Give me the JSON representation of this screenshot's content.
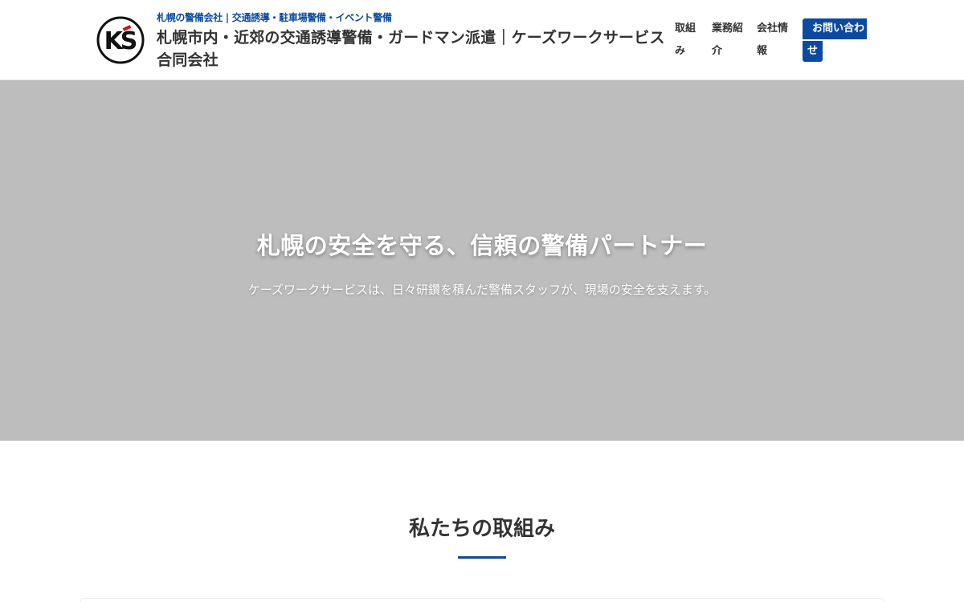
{
  "header": {
    "tagline": "札幌の警備会社 | 交通誘導・駐車場警備・イベント警備",
    "site_title": "札幌市内・近郊の交通誘導警備・ガードマン派遣｜ケーズワークサービス合同会社",
    "logo_text": "KS"
  },
  "nav": {
    "items": [
      {
        "label": "取組み"
      },
      {
        "label": "業務紹介"
      },
      {
        "label": "会社情報"
      }
    ],
    "contact_line1": "お問い合わ",
    "contact_line2": "せ"
  },
  "hero": {
    "title": "札幌の安全を守る、信頼の警備パートナー",
    "subtitle": "ケーズワークサービスは、日々研鑽を積んだ警備スタッフが、現場の安全を支えます。"
  },
  "section": {
    "title": "私たちの取組み"
  },
  "colors": {
    "brand": "#0b4aa0",
    "hero_bg": "#bdbdbd"
  }
}
